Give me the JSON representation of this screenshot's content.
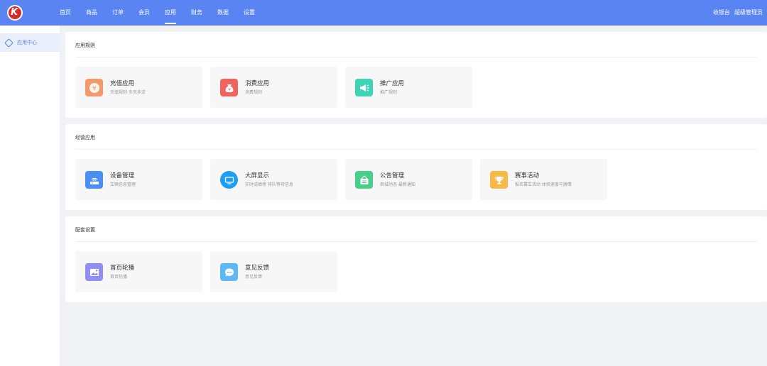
{
  "brand": {
    "logo_text": "K",
    "color": "#5b84f3"
  },
  "nav": {
    "items": [
      {
        "label": "首页"
      },
      {
        "label": "商品"
      },
      {
        "label": "订单"
      },
      {
        "label": "会员"
      },
      {
        "label": "应用",
        "active": true
      },
      {
        "label": "财务"
      },
      {
        "label": "数据"
      },
      {
        "label": "设置"
      }
    ],
    "cashier": "收银台",
    "admin": "超级管理员"
  },
  "sidebar": {
    "items": [
      {
        "label": "应用中心",
        "icon": "cube-icon"
      }
    ]
  },
  "sections": [
    {
      "title": "应用规则",
      "cards": [
        {
          "title": "充值应用",
          "desc": "充值规则 多充多送",
          "icon": "yen-icon",
          "color": "#f29a6b"
        },
        {
          "title": "消费应用",
          "desc": "消费规则",
          "icon": "money-bag-icon",
          "color": "#f2635f"
        },
        {
          "title": "推广应用",
          "desc": "推广规则",
          "icon": "megaphone-icon",
          "color": "#3fd3b6"
        }
      ]
    },
    {
      "title": "经营应用",
      "cards": [
        {
          "title": "设备管理",
          "desc": "车辆信息管理",
          "icon": "router-icon",
          "color": "#4a8ff5"
        },
        {
          "title": "大屏显示",
          "desc": "实时成绩榜 排队等待信息",
          "icon": "monitor-icon",
          "color": "#1e9ef2"
        },
        {
          "title": "公告管理",
          "desc": "商城动态 最新通知",
          "icon": "notice-board-icon",
          "color": "#48cf8a"
        },
        {
          "title": "赛事活动",
          "desc": "报名赛车活动 体验速度与激情",
          "icon": "trophy-icon",
          "color": "#f7b94a"
        }
      ]
    },
    {
      "title": "配套设置",
      "cards": [
        {
          "title": "首页轮播",
          "desc": "首页轮播",
          "icon": "image-icon",
          "color": "#8f8ef5"
        },
        {
          "title": "意见反馈",
          "desc": "意见反馈",
          "icon": "chat-bubble-icon",
          "color": "#5db8f5"
        }
      ]
    }
  ]
}
